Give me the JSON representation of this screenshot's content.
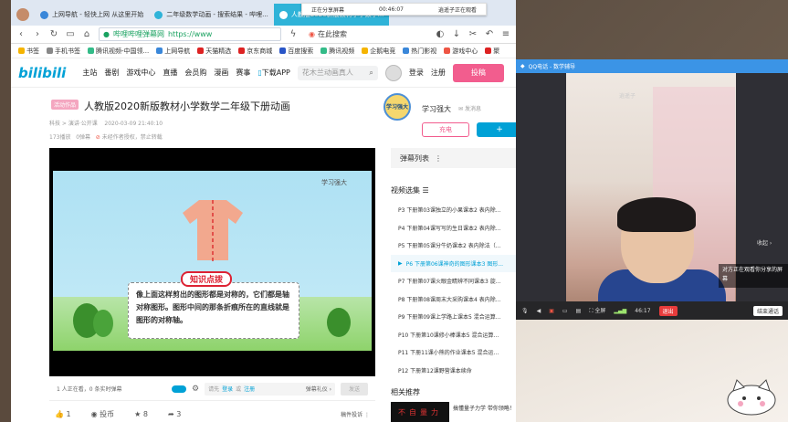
{
  "browser": {
    "tabs": [
      {
        "label": "上网导航 - 轻快上网 从这里开始",
        "active": false
      },
      {
        "label": "二年级数学动画 - 搜索结果 - 哔哩...",
        "active": false
      },
      {
        "label": "人教版2020新版教材小学数学...",
        "active": true
      }
    ],
    "url_text": "https://www",
    "url_green": "哔哩哔哩弹幕网",
    "search_placeholder": "在此搜索",
    "bookmarks": [
      "书签",
      "手机书签",
      "腾讯视频-中国领...",
      "上网导航",
      "天猫精选",
      "京东商城",
      "百度搜索",
      "腾讯视频",
      "企鹅电竞",
      "热门影视",
      "游戏中心",
      "聚"
    ]
  },
  "share_bar": {
    "status": "正在分享屏幕",
    "timer": "00:46:07",
    "viewer": "逍遥子正在观看"
  },
  "bili": {
    "logo": "bilibili",
    "nav": [
      "主站",
      "番剧",
      "游戏中心",
      "直播",
      "会员购",
      "漫画",
      "赛事",
      "下载APP"
    ],
    "search_placeholder": "花木兰动画真人",
    "login": "登录",
    "register": "注册",
    "upload": "投稿"
  },
  "video": {
    "tag": "活动作品",
    "title": "人教版2020新版教材小学数学二年级下册动画",
    "category": "科技 > 演讲·公开课",
    "date": "2020-03-09 21:40:10",
    "views": "173播放",
    "danmaku_count": "0弹幕",
    "rights": "未经作者授权，禁止转载",
    "watermark": "学习强大",
    "knowledge_title": "知识点拨",
    "knowledge_text": "像上面这样剪出的图形都是对称的，它们都是轴对称图形。图形中间的那条折痕所在的直线就是图形的对称轴。"
  },
  "uploader": {
    "avatar_text": "学习强大",
    "name": "学习强大",
    "message": "发消息",
    "charge": "充电",
    "follow": "+"
  },
  "player_bar": {
    "watching": "1 人正在看，0 条实时弹幕",
    "danmaku_hint": "请先",
    "login": "登录",
    "or": "或",
    "register": "注册",
    "etiquette": "弹幕礼仪 ›",
    "send": "发送"
  },
  "actions": {
    "like": "1",
    "coin": "投币",
    "favorite": "8",
    "share": "3",
    "report": "稿件投诉"
  },
  "sidebar": {
    "danmaku_list": "弹幕列表",
    "episodes_title": "视频选集",
    "episodes": [
      {
        "label": "P3  下册第03课独立的小果课本2 表内除...",
        "active": false
      },
      {
        "label": "P4  下册第04课写写的生日课本2 表内除...",
        "active": false
      },
      {
        "label": "P5  下册第05课分牛奶课本2 表内除法（...",
        "active": false
      },
      {
        "label": "P6  下册第06课神奇的图形课本3 图形...",
        "active": true
      },
      {
        "label": "P7  下册第07课火眼金睛辨不同课本3 旋...",
        "active": false
      },
      {
        "label": "P8  下册第08课周末大采购课本4 表内除...",
        "active": false
      },
      {
        "label": "P9  下册第09课上学路上课本5 混合运算...",
        "active": false
      },
      {
        "label": "P10  下册第10课修小棒课本5 混合运算...",
        "active": false
      },
      {
        "label": "P11  下册11课小熊的作业课本5 混合运...",
        "active": false
      },
      {
        "label": "P12  下册第12课野营课本续命",
        "active": false
      }
    ],
    "related_title": "相关推荐",
    "related_thumb": "不自量力",
    "related_text": "搞懂量子力学 带你领略！"
  },
  "qq": {
    "title": "QQ电话 - 数学辅导",
    "self_name": "逍遥子",
    "collapse": "收起",
    "share_tip": "对方正在观看你分享的屏幕",
    "fullscreen": "全屏",
    "signal": "46:17",
    "exit": "退出",
    "end": "结束通话"
  },
  "colors": {
    "bili_blue": "#00a1d6",
    "bili_pink": "#f25d8e",
    "qq_blue": "#3b94e6",
    "exit_red": "#e83c3c"
  }
}
